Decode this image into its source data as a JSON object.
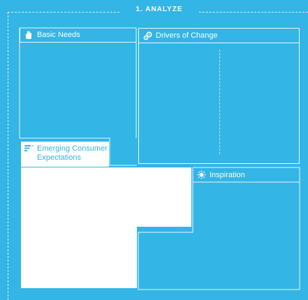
{
  "section": {
    "title": "1. ANALYZE"
  },
  "boxes": {
    "basic_needs": {
      "label": "Basic Needs",
      "icon": "hand-icon"
    },
    "drivers_of_change": {
      "label": "Drivers of Change",
      "icon": "gears-icon"
    },
    "emerging_consumer_expectations": {
      "label_line1": "Emerging Consumer",
      "label_line2": "Expectations",
      "icon": "flag-icon"
    },
    "inspiration": {
      "label": "Inspiration",
      "icon": "burst-icon"
    }
  },
  "colors": {
    "background": "#33b5e5",
    "foreground": "#ffffff"
  }
}
